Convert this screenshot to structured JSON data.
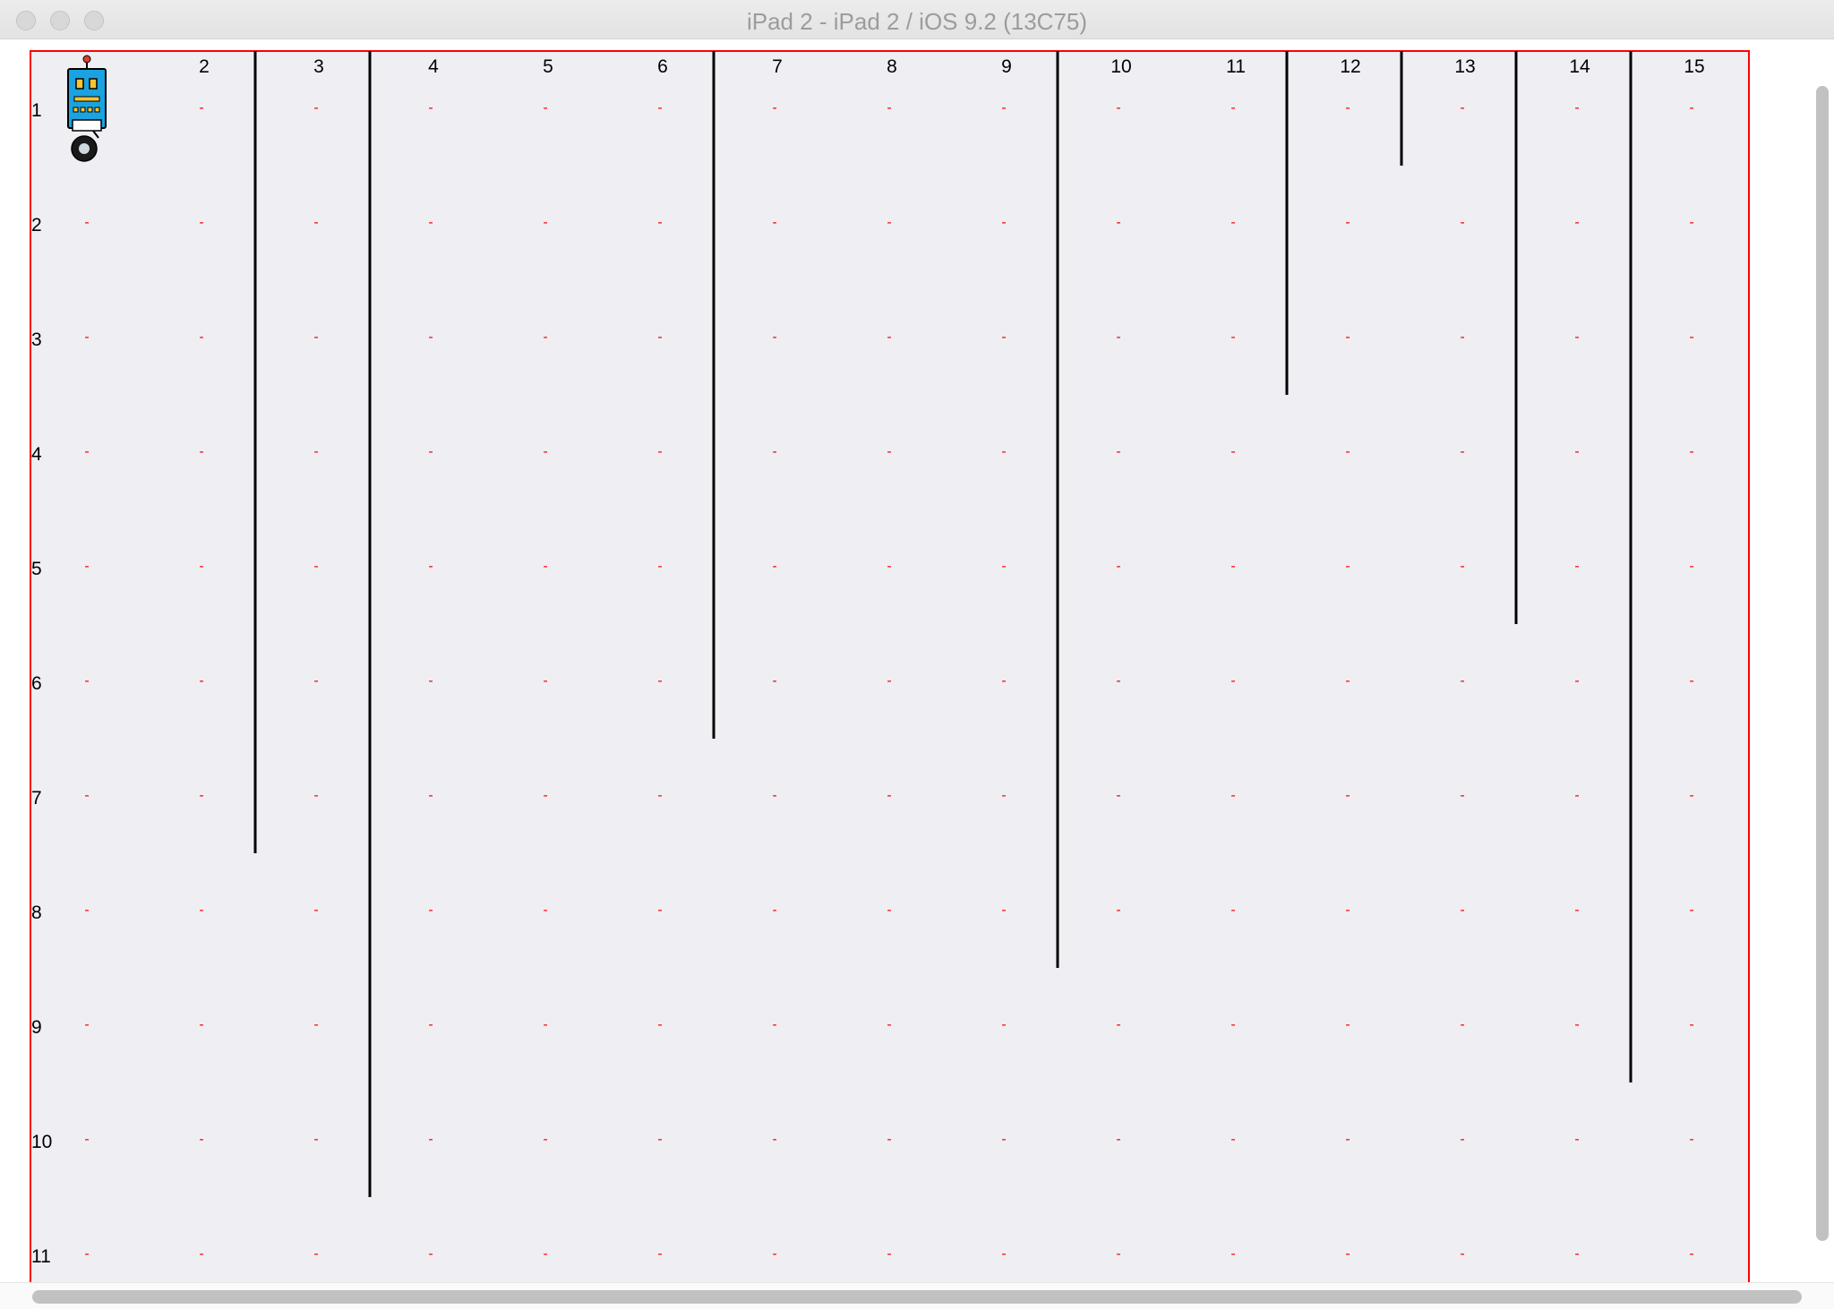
{
  "window": {
    "title": "iPad 2 - iPad 2 / iOS 9.2 (13C75)",
    "buttons": [
      "close-button",
      "minimize-button",
      "zoom-button"
    ]
  },
  "board": {
    "columns": 15,
    "rows": 11,
    "column_labels": [
      "",
      "2",
      "3",
      "4",
      "5",
      "6",
      "7",
      "8",
      "9",
      "10",
      "11",
      "12",
      "13",
      "14",
      "15"
    ],
    "row_labels": [
      "1",
      "2",
      "3",
      "4",
      "5",
      "6",
      "7",
      "8",
      "9",
      "10",
      "11"
    ],
    "cell_marker": "-",
    "colors": {
      "background": "#efeef3",
      "border": "#ff0000",
      "marker": "#ff0000",
      "wall": "#000000",
      "label": "#000000",
      "robot_body": "#1aa3e0",
      "robot_eyes": "#f6c431"
    },
    "walls": [
      {
        "between_columns": [
          2,
          3
        ],
        "from_row": 1,
        "to_row": 7
      },
      {
        "between_columns": [
          3,
          4
        ],
        "from_row": 1,
        "to_row": 10
      },
      {
        "between_columns": [
          6,
          7
        ],
        "from_row": 1,
        "to_row": 6
      },
      {
        "between_columns": [
          9,
          10
        ],
        "from_row": 1,
        "to_row": 8
      },
      {
        "between_columns": [
          11,
          12
        ],
        "from_row": 1,
        "to_row": 3
      },
      {
        "between_columns": [
          12,
          13
        ],
        "from_row": 1,
        "to_row": 1
      },
      {
        "between_columns": [
          13,
          14
        ],
        "from_row": 1,
        "to_row": 5
      },
      {
        "between_columns": [
          14,
          15
        ],
        "from_row": 1,
        "to_row": 9
      }
    ],
    "robot": {
      "column": 1,
      "row": 1,
      "icon": "robot-icon",
      "facing": "right"
    }
  }
}
